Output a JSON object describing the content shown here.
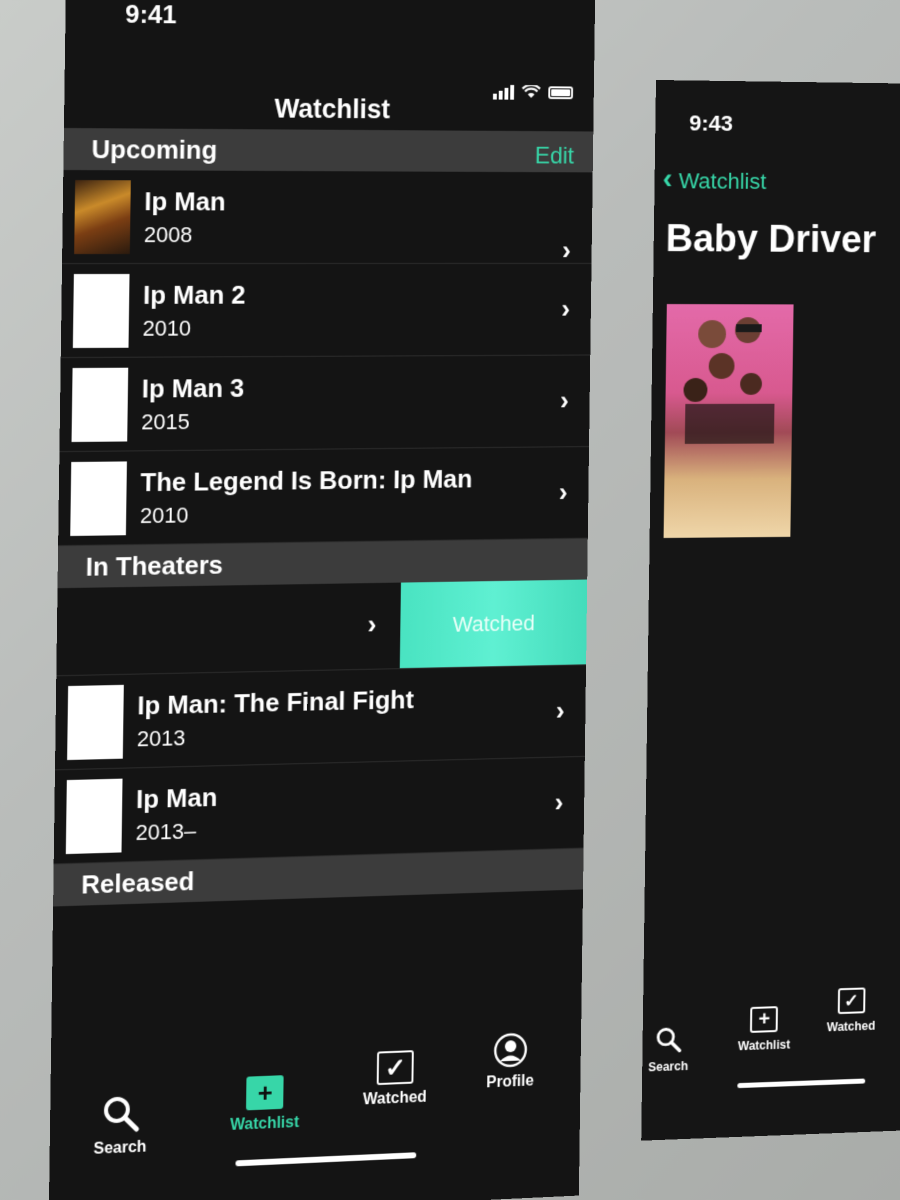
{
  "left_screen": {
    "status": {
      "time": "9:41"
    },
    "nav": {
      "title": "Watchlist",
      "edit_label": "Edit"
    },
    "sections": {
      "upcoming": "Upcoming",
      "in_theaters": "In Theaters",
      "released": "Released"
    },
    "upcoming_items": [
      {
        "title": "Ip Man",
        "year": "2008"
      },
      {
        "title": "Ip Man 2",
        "year": "2010"
      },
      {
        "title": "Ip Man 3",
        "year": "2015"
      },
      {
        "title": "The Legend Is Born: Ip Man",
        "year": "2010"
      }
    ],
    "swipe_action": {
      "label": "Watched"
    },
    "theater_items": [
      {
        "title": "Ip Man: The Final Fight",
        "year": "2013"
      },
      {
        "title": "Ip Man",
        "year": "2013–"
      }
    ],
    "tabs": [
      {
        "label": "Search",
        "icon": "search-icon"
      },
      {
        "label": "Watchlist",
        "icon": "watchlist-icon"
      },
      {
        "label": "Watched",
        "icon": "checkmark-icon"
      },
      {
        "label": "Profile",
        "icon": "profile-icon"
      }
    ]
  },
  "right_screen": {
    "status": {
      "time": "9:43"
    },
    "back_label": "Watchlist",
    "title": "Baby Driver",
    "tabs": [
      {
        "label": "Search",
        "icon": "search-icon"
      },
      {
        "label": "Watchlist",
        "icon": "watchlist-icon"
      },
      {
        "label": "Watched",
        "icon": "checkmark-icon"
      }
    ]
  },
  "colors": {
    "accent": "#37d6a8",
    "background": "#141414",
    "section_header": "#3c3c3c",
    "swipe_action": "#49e3c1"
  }
}
